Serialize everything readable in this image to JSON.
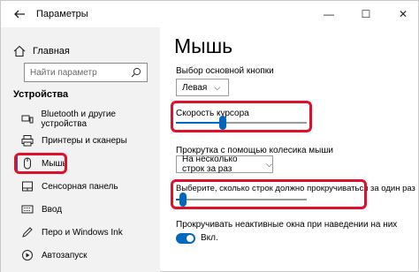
{
  "window": {
    "title": "Параметры",
    "controls": {
      "minimize": "—",
      "maximize": "☐",
      "close": "✕"
    }
  },
  "sidebar": {
    "home_label": "Главная",
    "search_placeholder": "Найти параметр",
    "section_title": "Устройства",
    "items": [
      {
        "label": "Bluetooth и другие устройства",
        "icon": "bluetooth-icon"
      },
      {
        "label": "Принтеры и сканеры",
        "icon": "printer-icon"
      },
      {
        "label": "Мышь",
        "icon": "mouse-icon",
        "selected": true
      },
      {
        "label": "Сенсорная панель",
        "icon": "touchpad-icon"
      },
      {
        "label": "Ввод",
        "icon": "keyboard-icon"
      },
      {
        "label": "Перо и Windows Ink",
        "icon": "pen-icon"
      },
      {
        "label": "Автозапуск",
        "icon": "autoplay-icon"
      }
    ]
  },
  "main": {
    "title": "Мышь",
    "primary_button_label": "Выбор основной кнопки",
    "primary_button_value": "Левая",
    "cursor_speed_label": "Скорость курсора",
    "cursor_speed_percent": 35,
    "wheel_label": "Прокрутка с помощью колесика мыши",
    "wheel_value": "На несколько строк за раз",
    "lines_label": "Выберите, сколько строк должно прокручиваться за один раз",
    "lines_percent": 3,
    "inactive_label": "Прокручивать неактивные окна при наведении на них",
    "inactive_state": "Вкл."
  },
  "colors": {
    "accent": "#0067c0",
    "highlight": "#e0102a",
    "sidebar_bg": "#f2f2f2"
  }
}
